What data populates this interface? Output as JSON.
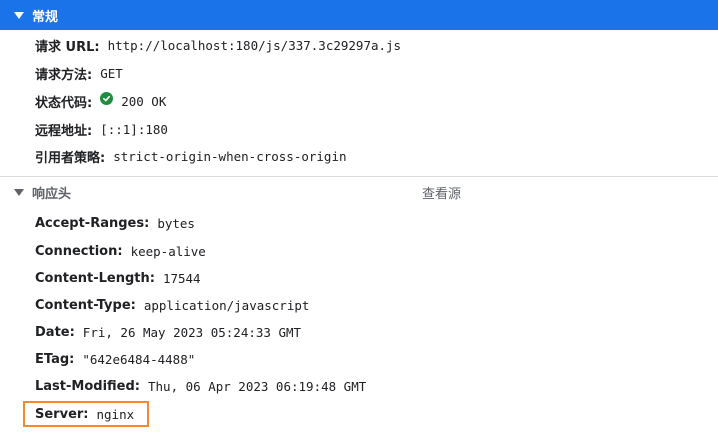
{
  "general": {
    "title": "常规",
    "request_url": {
      "key": "请求 URL:",
      "value": "http://localhost:180/js/337.3c29297a.js"
    },
    "request_method": {
      "key": "请求方法:",
      "value": "GET"
    },
    "status_code": {
      "key": "状态代码:",
      "value": "200 OK"
    },
    "remote_address": {
      "key": "远程地址:",
      "value": "[::1]:180"
    },
    "referrer_policy": {
      "key": "引用者策略:",
      "value": "strict-origin-when-cross-origin"
    }
  },
  "response_headers": {
    "title": "响应头",
    "view_source_label": "查看源",
    "items": [
      {
        "key": "Accept-Ranges:",
        "value": "bytes"
      },
      {
        "key": "Connection:",
        "value": "keep-alive"
      },
      {
        "key": "Content-Length:",
        "value": "17544"
      },
      {
        "key": "Content-Type:",
        "value": "application/javascript"
      },
      {
        "key": "Date:",
        "value": "Fri, 26 May 2023 05:24:33 GMT"
      },
      {
        "key": "ETag:",
        "value": "\"642e6484-4488\""
      },
      {
        "key": "Last-Modified:",
        "value": "Thu, 06 Apr 2023 06:19:48 GMT"
      },
      {
        "key": "Server:",
        "value": "nginx"
      }
    ]
  },
  "colors": {
    "header_bg": "#1a73e8",
    "status_ok": "#1e8e3e",
    "highlight": "#f28b30"
  }
}
